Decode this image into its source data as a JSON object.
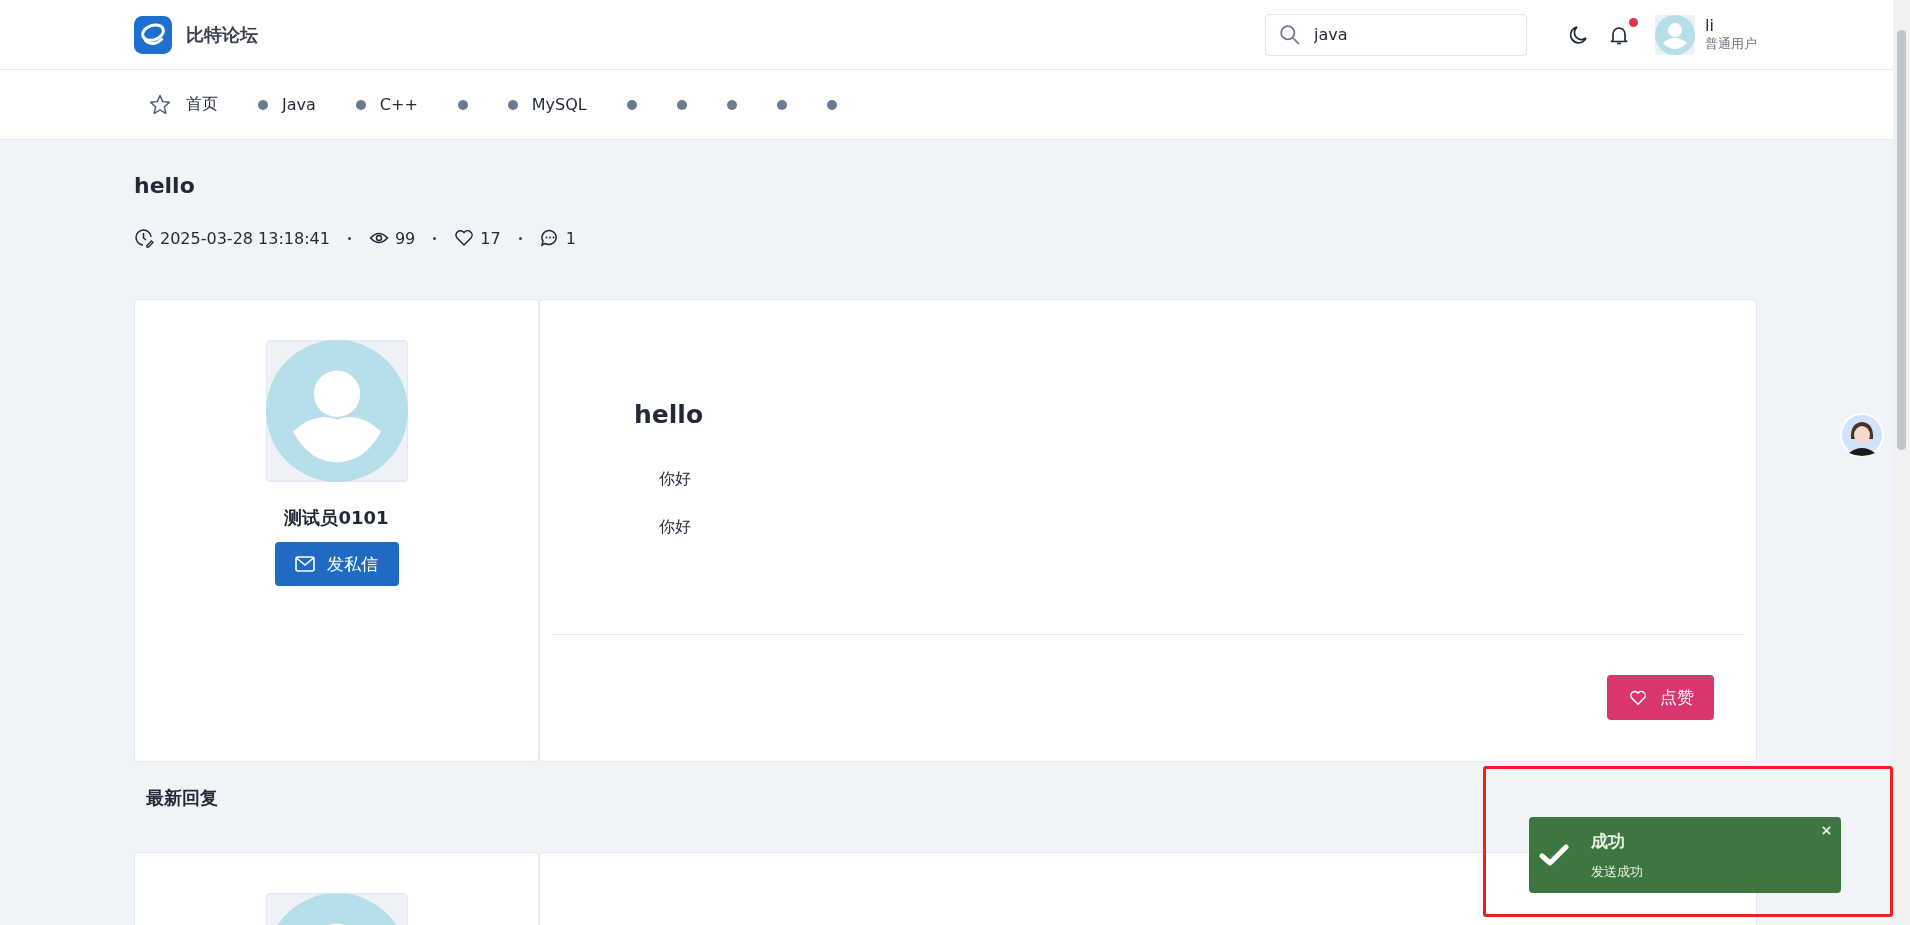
{
  "header": {
    "site_name": "比特论坛",
    "search": {
      "value": "java"
    },
    "notification": {
      "unread": true
    },
    "user": {
      "name": "li",
      "role": "普通用户"
    }
  },
  "nav": [
    {
      "kind": "home",
      "label": "首页"
    },
    {
      "kind": "board",
      "label": "Java"
    },
    {
      "kind": "board",
      "label": "C++"
    },
    {
      "kind": "board"
    },
    {
      "kind": "board",
      "label": "MySQL"
    },
    {
      "kind": "board"
    },
    {
      "kind": "board"
    },
    {
      "kind": "board"
    },
    {
      "kind": "board"
    },
    {
      "kind": "board"
    }
  ],
  "post": {
    "title": "hello",
    "time": "2025-03-28 13:18:41",
    "views": "99",
    "likes": "17",
    "comments": "1",
    "author": "测试员0101",
    "message_button": "发私信",
    "heading": "hello",
    "paragraphs": [
      "你好",
      "你好"
    ],
    "like_button": "点赞"
  },
  "replies": {
    "title": "最新回复"
  },
  "toast": {
    "title": "成功",
    "message": "发送成功"
  }
}
